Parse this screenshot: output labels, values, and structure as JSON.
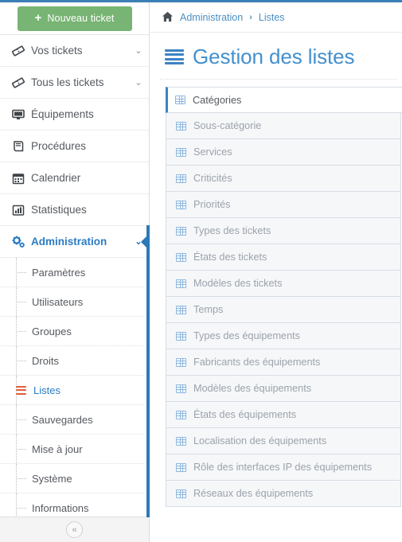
{
  "theme": {
    "accent_blue": "#3b7fb5",
    "link_blue": "#4390ce",
    "active_blue": "#2d79b8",
    "green": "#78b474",
    "orange": "#e05d3a",
    "muted_text": "#9aa3ab"
  },
  "sidebar": {
    "new_ticket": {
      "label": "Nouveau ticket",
      "icon": "plus-icon"
    },
    "nav": [
      {
        "label": "Vos tickets",
        "icon": "ticket-icon",
        "caret": "⌄",
        "active": false
      },
      {
        "label": "Tous les tickets",
        "icon": "ticket-icon",
        "caret": "⌄",
        "active": false
      },
      {
        "label": "Équipements",
        "icon": "monitor-icon",
        "caret": "",
        "active": false
      },
      {
        "label": "Procédures",
        "icon": "book-icon",
        "caret": "",
        "active": false
      },
      {
        "label": "Calendrier",
        "icon": "calendar-icon",
        "caret": "",
        "active": false
      },
      {
        "label": "Statistiques",
        "icon": "bar-chart-icon",
        "caret": "",
        "active": false
      },
      {
        "label": "Administration",
        "icon": "gears-icon",
        "caret": "⌄",
        "active": true
      }
    ],
    "submenu": [
      {
        "label": "Paramètres",
        "active": false,
        "icon": ""
      },
      {
        "label": "Utilisateurs",
        "active": false,
        "icon": ""
      },
      {
        "label": "Groupes",
        "active": false,
        "icon": ""
      },
      {
        "label": "Droits",
        "active": false,
        "icon": ""
      },
      {
        "label": "Listes",
        "active": true,
        "icon": "list-icon"
      },
      {
        "label": "Sauvegardes",
        "active": false,
        "icon": ""
      },
      {
        "label": "Mise à jour",
        "active": false,
        "icon": ""
      },
      {
        "label": "Système",
        "active": false,
        "icon": ""
      },
      {
        "label": "Informations",
        "active": false,
        "icon": ""
      }
    ],
    "collapse_button": {
      "glyph": "«",
      "icon": "chevron-double-left-icon"
    }
  },
  "content": {
    "breadcrumb": {
      "home_icon": "home-icon",
      "items": [
        "Administration",
        "Listes"
      ],
      "separator": "›"
    },
    "page_title": {
      "text": "Gestion des listes",
      "icon": "list-lines-icon"
    },
    "lists": [
      {
        "label": "Catégories",
        "icon": "table-icon",
        "active": true
      },
      {
        "label": "Sous-catégorie",
        "icon": "table-icon",
        "active": false
      },
      {
        "label": "Services",
        "icon": "table-icon",
        "active": false
      },
      {
        "label": "Criticités",
        "icon": "table-icon",
        "active": false
      },
      {
        "label": "Priorités",
        "icon": "table-icon",
        "active": false
      },
      {
        "label": "Types des tickets",
        "icon": "table-icon",
        "active": false
      },
      {
        "label": "États des tickets",
        "icon": "table-icon",
        "active": false
      },
      {
        "label": "Modèles des tickets",
        "icon": "table-icon",
        "active": false
      },
      {
        "label": "Temps",
        "icon": "table-icon",
        "active": false
      },
      {
        "label": "Types des équipements",
        "icon": "table-icon",
        "active": false
      },
      {
        "label": "Fabricants des équipements",
        "icon": "table-icon",
        "active": false
      },
      {
        "label": "Modèles des équipements",
        "icon": "table-icon",
        "active": false
      },
      {
        "label": "États des équipements",
        "icon": "table-icon",
        "active": false
      },
      {
        "label": "Localisation des équipements",
        "icon": "table-icon",
        "active": false
      },
      {
        "label": "Rôle des interfaces IP des équipements",
        "icon": "table-icon",
        "active": false
      },
      {
        "label": "Réseaux des équipements",
        "icon": "table-icon",
        "active": false
      }
    ]
  }
}
